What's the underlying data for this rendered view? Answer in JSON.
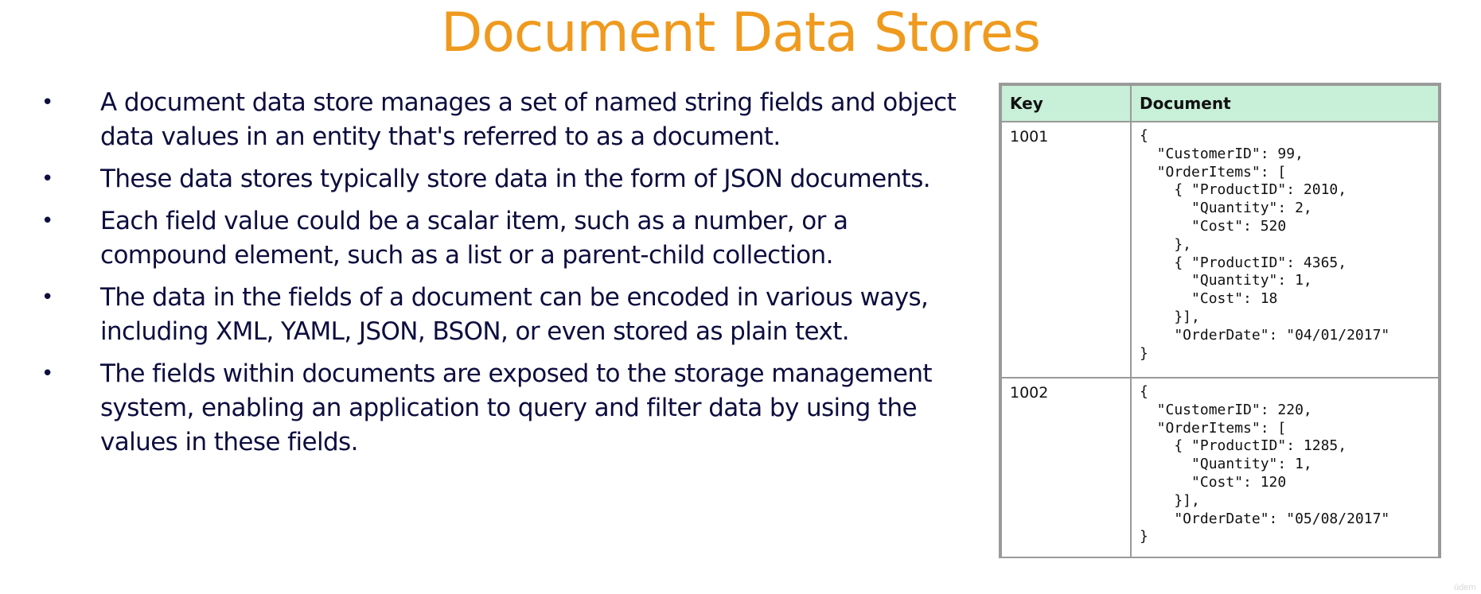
{
  "slide": {
    "title": "Document Data Stores",
    "bullet_glyph": "•",
    "bullets": [
      "A document data store manages a set of named string fields and object data values in an entity that's referred to as a document.",
      "These data stores typically store data in the form of JSON documents.",
      "Each field value could be a scalar item, such as a number, or a compound element, such as a list or a parent-child collection.",
      "The data in the fields of a document can be encoded in various ways, including XML, YAML, JSON, BSON, or even stored as plain text.",
      "The fields within documents are exposed to the storage management system, enabling an application to query and filter data by using the values in these fields."
    ]
  },
  "table": {
    "headers": {
      "key": "Key",
      "document": "Document"
    },
    "rows": [
      {
        "key": "1001",
        "document": "{\n  \"CustomerID\": 99,\n  \"OrderItems\": [\n    { \"ProductID\": 2010,\n      \"Quantity\": 2,\n      \"Cost\": 520\n    },\n    { \"ProductID\": 4365,\n      \"Quantity\": 1,\n      \"Cost\": 18\n    }],\n    \"OrderDate\": \"04/01/2017\"\n}"
      },
      {
        "key": "1002",
        "document": "{\n  \"CustomerID\": 220,\n  \"OrderItems\": [\n    { \"ProductID\": 1285,\n      \"Quantity\": 1,\n      \"Cost\": 120\n    }],\n    \"OrderDate\": \"05/08/2017\"\n}"
      }
    ]
  },
  "watermark": "ûdem",
  "colors": {
    "title": "#ef9a1e",
    "body_text": "#0d0d3f",
    "table_header_bg": "#c8efd8",
    "table_border": "#9a9a9a"
  }
}
